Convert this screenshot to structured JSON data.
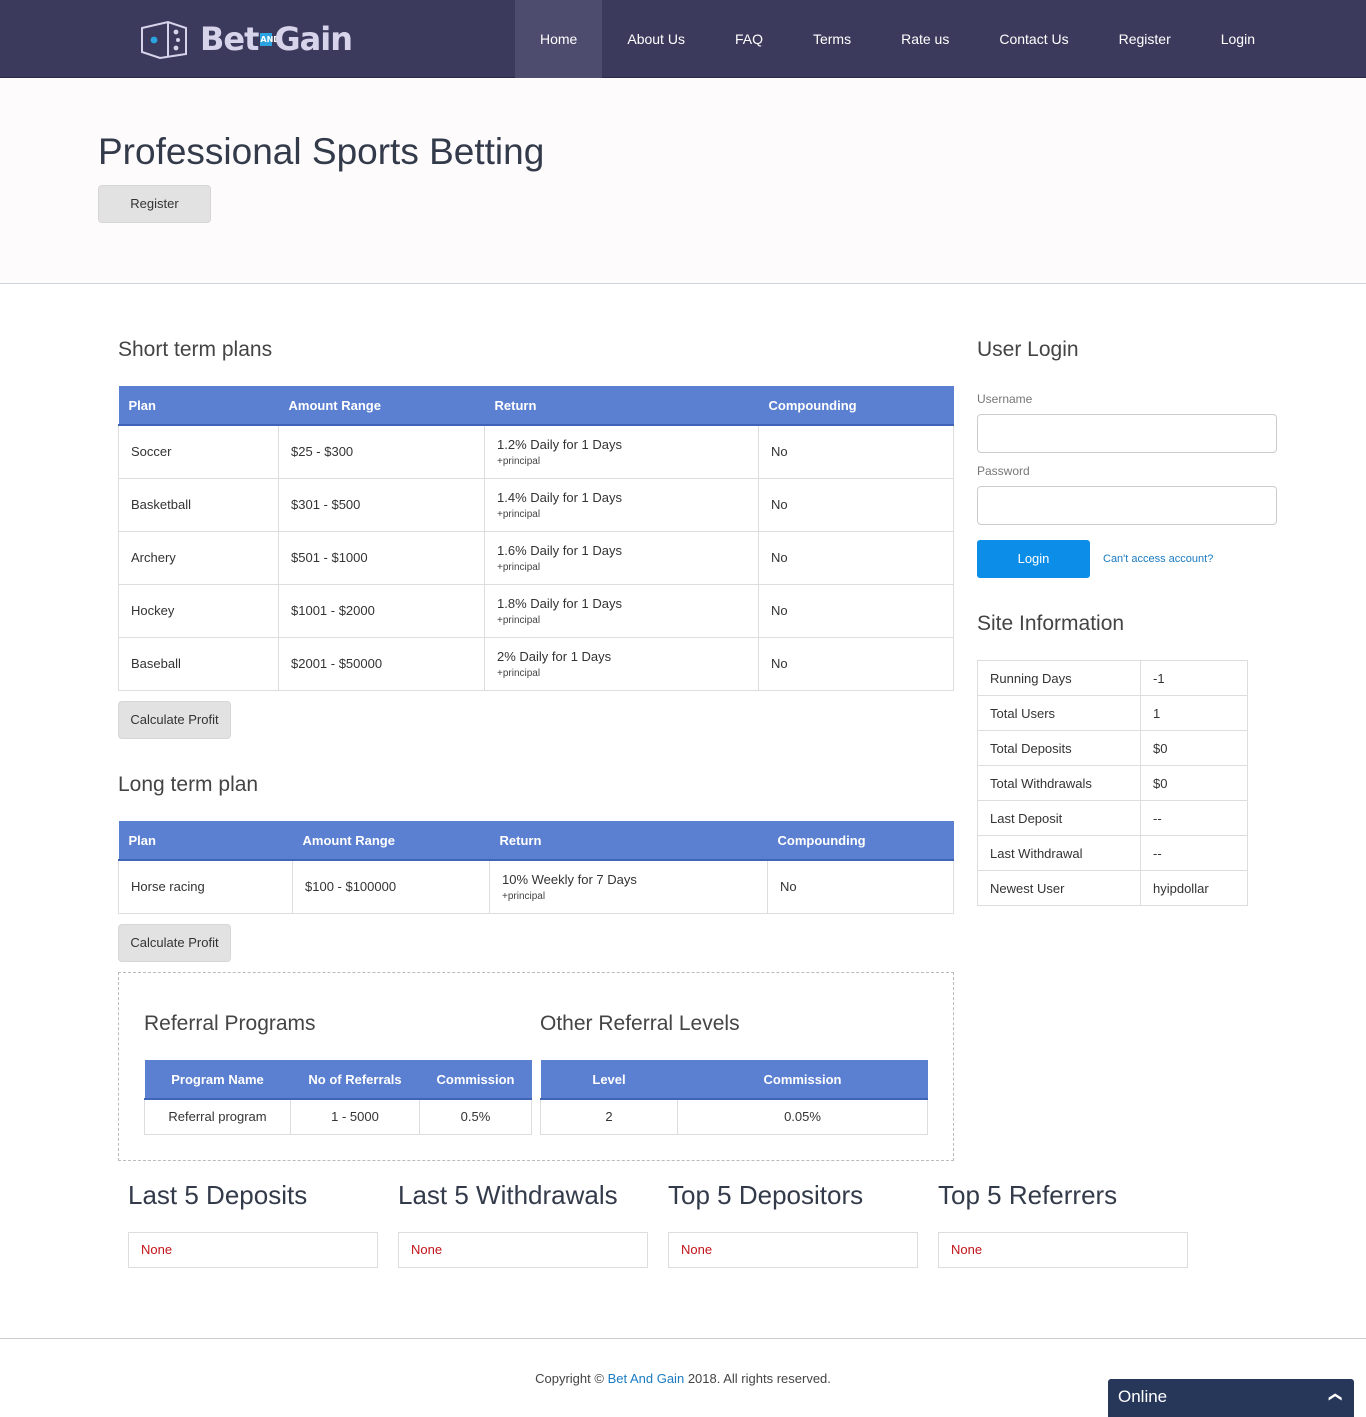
{
  "nav": {
    "logo": {
      "word1": "Bet",
      "word2": "AND",
      "word3": "Gain"
    },
    "items": [
      "Home",
      "About Us",
      "FAQ",
      "Terms",
      "Rate us",
      "Contact Us",
      "Register",
      "Login"
    ],
    "active": "Home"
  },
  "hero": {
    "title": "Professional Sports Betting",
    "register_label": "Register"
  },
  "short_term": {
    "title": "Short term plans",
    "headers": [
      "Plan",
      "Amount Range",
      "Return",
      "Compounding"
    ],
    "rows": [
      {
        "plan": "Soccer",
        "range": "$25 - $300",
        "return": "1.2% Daily for 1 Days",
        "note": "+principal",
        "compounding": "No"
      },
      {
        "plan": "Basketball",
        "range": "$301 - $500",
        "return": "1.4% Daily for 1 Days",
        "note": "+principal",
        "compounding": "No"
      },
      {
        "plan": "Archery",
        "range": "$501 - $1000",
        "return": "1.6% Daily for 1 Days",
        "note": "+principal",
        "compounding": "No"
      },
      {
        "plan": "Hockey",
        "range": "$1001 - $2000",
        "return": "1.8% Daily for 1 Days",
        "note": "+principal",
        "compounding": "No"
      },
      {
        "plan": "Baseball",
        "range": "$2001 - $50000",
        "return": "2% Daily for 1 Days",
        "note": "+principal",
        "compounding": "No"
      }
    ],
    "calc_label": "Calculate Profit"
  },
  "long_term": {
    "title": "Long term plan",
    "headers": [
      "Plan",
      "Amount Range",
      "Return",
      "Compounding"
    ],
    "rows": [
      {
        "plan": "Horse racing",
        "range": "$100 - $100000",
        "return": "10% Weekly for 7 Days",
        "note": "+principal",
        "compounding": "No"
      }
    ],
    "calc_label": "Calculate Profit"
  },
  "referral": {
    "title": "Referral Programs",
    "headers": [
      "Program Name",
      "No of Referrals",
      "Commission"
    ],
    "row": [
      "Referral program",
      "1 - 5000",
      "0.5%"
    ],
    "other_title": "Other Referral Levels",
    "other_headers": [
      "Level",
      "Commission"
    ],
    "other_row": [
      "2",
      "0.05%"
    ]
  },
  "login": {
    "title": "User Login",
    "username_label": "Username",
    "password_label": "Password",
    "button": "Login",
    "forgot": "Can't access account?"
  },
  "site_info": {
    "title": "Site Information",
    "rows": [
      [
        "Running Days",
        "-1"
      ],
      [
        "Total Users",
        "1"
      ],
      [
        "Total Deposits",
        "$0"
      ],
      [
        "Total Withdrawals",
        "$0"
      ],
      [
        "Last Deposit",
        "--"
      ],
      [
        "Last Withdrawal",
        "--"
      ],
      [
        "Newest User",
        "hyipdollar"
      ]
    ]
  },
  "stats": [
    {
      "title": "Last 5 Deposits",
      "value": "None"
    },
    {
      "title": "Last 5 Withdrawals",
      "value": "None"
    },
    {
      "title": "Top 5 Depositors",
      "value": "None"
    },
    {
      "title": "Top 5 Referrers",
      "value": "None"
    }
  ],
  "footer": {
    "prefix": "Copyright ©",
    "brand": "Bet And Gain",
    "suffix": "2018. All rights reserved."
  },
  "chat": {
    "label": "Online"
  }
}
